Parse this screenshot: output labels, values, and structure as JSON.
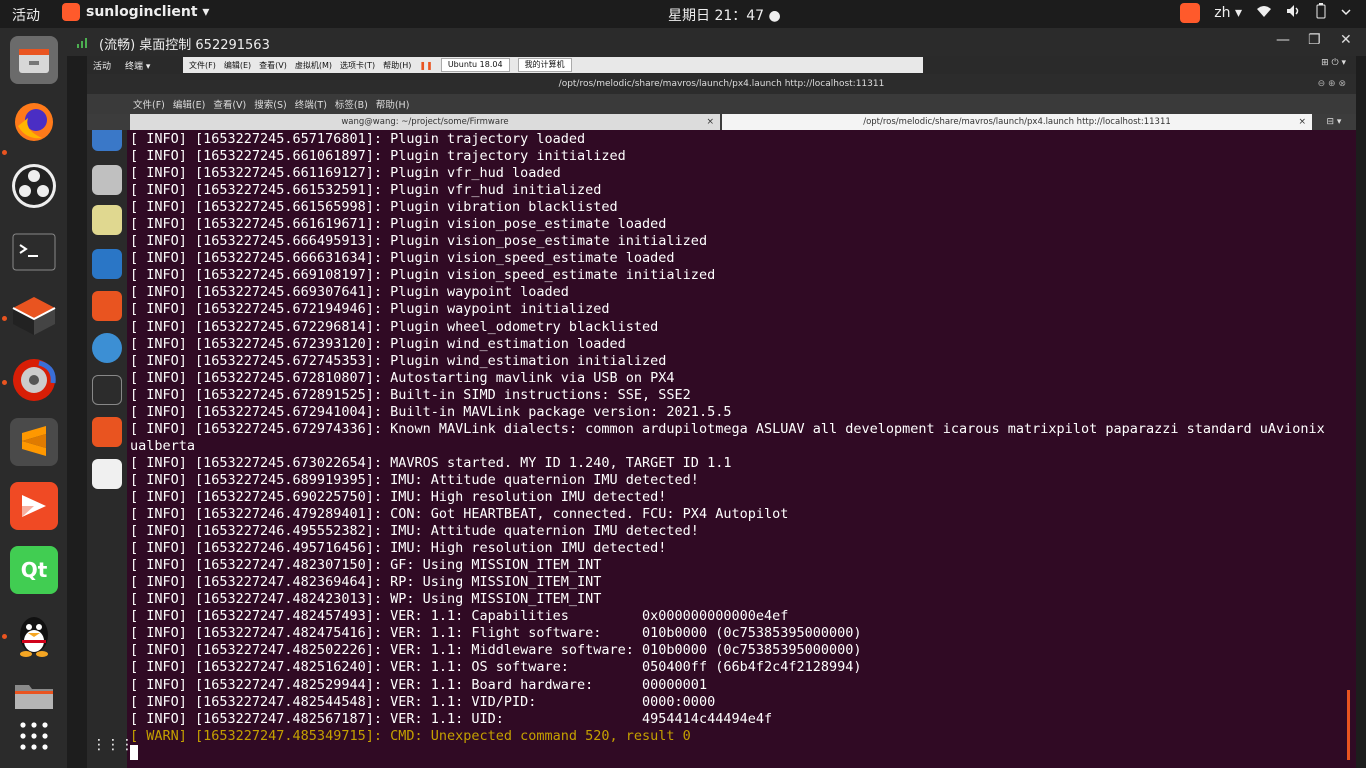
{
  "topbar": {
    "activities": "活动",
    "app_name": "sunloginclient ▾",
    "clock": "星期日 21：47 ●",
    "lang": "zh ▾",
    "status_icons": [
      "wifi-icon",
      "volume-icon",
      "battery-icon",
      "power-menu-icon"
    ]
  },
  "dock": {
    "items": [
      "files-icon",
      "firefox-icon",
      "obs-icon",
      "terminal-icon",
      "box-icon",
      "netease-music-icon",
      "sublime-icon",
      "sunlogin-icon",
      "qt-icon",
      "qq-icon",
      "folder-icon",
      "show-apps-icon"
    ]
  },
  "remote_window": {
    "title": "(流畅) 桌面控制 652291563"
  },
  "vm": {
    "activities": "活动",
    "terminal_menu": "终端 ▾",
    "toolbar_items": [
      "文件(F)",
      "编辑(E)",
      "查看(V)",
      "虚拟机(M)",
      "选项卡(T)",
      "帮助(H)"
    ],
    "tab_ubuntu": "Ubuntu 18.04",
    "tab_mypc": "我的计算机"
  },
  "terminal_window": {
    "title": "/opt/ros/melodic/share/mavros/launch/px4.launch http://localhost:11311",
    "menu": [
      "文件(F)",
      "编辑(E)",
      "查看(V)",
      "搜索(S)",
      "终端(T)",
      "标签(B)",
      "帮助(H)"
    ],
    "tabs": [
      {
        "label": "wang@wang: ~/project/some/Firmware"
      },
      {
        "label": "/opt/ros/melodic/share/mavros/launch/px4.launch http://localhost:11311"
      }
    ]
  },
  "log": [
    "[ INFO] [1653227245.657176801]: Plugin trajectory loaded",
    "[ INFO] [1653227245.661061897]: Plugin trajectory initialized",
    "[ INFO] [1653227245.661169127]: Plugin vfr_hud loaded",
    "[ INFO] [1653227245.661532591]: Plugin vfr_hud initialized",
    "[ INFO] [1653227245.661565998]: Plugin vibration blacklisted",
    "[ INFO] [1653227245.661619671]: Plugin vision_pose_estimate loaded",
    "[ INFO] [1653227245.666495913]: Plugin vision_pose_estimate initialized",
    "[ INFO] [1653227245.666631634]: Plugin vision_speed_estimate loaded",
    "[ INFO] [1653227245.669108197]: Plugin vision_speed_estimate initialized",
    "[ INFO] [1653227245.669307641]: Plugin waypoint loaded",
    "[ INFO] [1653227245.672194946]: Plugin waypoint initialized",
    "[ INFO] [1653227245.672296814]: Plugin wheel_odometry blacklisted",
    "[ INFO] [1653227245.672393120]: Plugin wind_estimation loaded",
    "[ INFO] [1653227245.672745353]: Plugin wind_estimation initialized",
    "[ INFO] [1653227245.672810807]: Autostarting mavlink via USB on PX4",
    "[ INFO] [1653227245.672891525]: Built-in SIMD instructions: SSE, SSE2",
    "[ INFO] [1653227245.672941004]: Built-in MAVLink package version: 2021.5.5",
    "[ INFO] [1653227245.672974336]: Known MAVLink dialects: common ardupilotmega ASLUAV all development icarous matrixpilot paparazzi standard uAvionix ualberta",
    "[ INFO] [1653227245.673022654]: MAVROS started. MY ID 1.240, TARGET ID 1.1",
    "[ INFO] [1653227245.689919395]: IMU: Attitude quaternion IMU detected!",
    "[ INFO] [1653227245.690225750]: IMU: High resolution IMU detected!",
    "[ INFO] [1653227246.479289401]: CON: Got HEARTBEAT, connected. FCU: PX4 Autopilot",
    "[ INFO] [1653227246.495552382]: IMU: Attitude quaternion IMU detected!",
    "[ INFO] [1653227246.495716456]: IMU: High resolution IMU detected!",
    "[ INFO] [1653227247.482307150]: GF: Using MISSION_ITEM_INT",
    "[ INFO] [1653227247.482369464]: RP: Using MISSION_ITEM_INT",
    "[ INFO] [1653227247.482423013]: WP: Using MISSION_ITEM_INT",
    "[ INFO] [1653227247.482457493]: VER: 1.1: Capabilities         0x000000000000e4ef",
    "[ INFO] [1653227247.482475416]: VER: 1.1: Flight software:     010b0000 (0c75385395000000)",
    "[ INFO] [1653227247.482502226]: VER: 1.1: Middleware software: 010b0000 (0c75385395000000)",
    "[ INFO] [1653227247.482516240]: VER: 1.1: OS software:         050400ff (66b4f2c4f2128994)",
    "[ INFO] [1653227247.482529944]: VER: 1.1: Board hardware:      00000001",
    "[ INFO] [1653227247.482544548]: VER: 1.1: VID/PID:             0000:0000",
    "[ INFO] [1653227247.482567187]: VER: 1.1: UID:                 4954414c44494e4f"
  ],
  "warn": "[ WARN] [1653227247.485349715]: CMD: Unexpected command 520, result 0",
  "colors": {
    "terminal_bg": "#300a24",
    "terminal_fg": "#ffffff",
    "warn_fg": "#c4a000",
    "ubuntu_orange": "#e95420"
  }
}
